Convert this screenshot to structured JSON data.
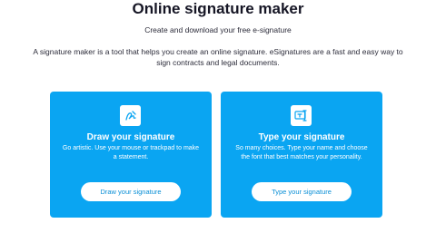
{
  "header": {
    "title": "Online signature maker",
    "subtitle": "Create and download your free e-signature",
    "description": "A signature maker is a tool that helps you create an online signature. eSignatures are a fast and easy way to sign contracts and legal documents."
  },
  "cards": [
    {
      "icon": "pen-signature-icon",
      "title": "Draw your signature",
      "text": "Go artistic. Use your mouse or trackpad to make a statement.",
      "button_label": "Draw your signature"
    },
    {
      "icon": "text-cursor-icon",
      "title": "Type your signature",
      "text": "So many choices. Type your name and choose the font that best matches your personality.",
      "button_label": "Type your signature"
    }
  ],
  "colors": {
    "card_background": "#0aa5f2",
    "button_text": "#0a8fd6",
    "heading": "#161625"
  }
}
